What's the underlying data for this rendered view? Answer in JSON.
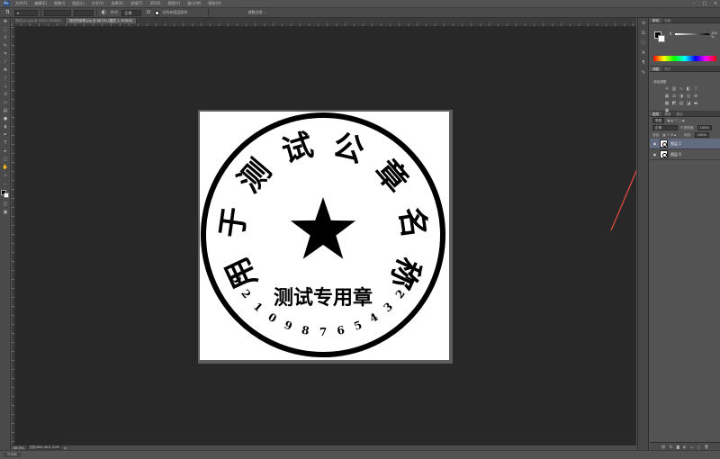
{
  "menu": {
    "app_logo": "Ps",
    "items": [
      "文件(F)",
      "编辑(E)",
      "图像(I)",
      "图层(L)",
      "文字(Y)",
      "选择(S)",
      "滤镜(T)",
      "3D(D)",
      "视图(V)",
      "窗口(W)",
      "帮助(H)"
    ]
  },
  "options": {
    "tool_icon": "quick-select-icon",
    "style_value": "正常",
    "sample_label": "样式:",
    "checkbox_label": "对所有图层取样",
    "edge_button": "调整边缘..."
  },
  "doc": {
    "tabs": [
      "测试-p1.jpg @ 100% (RGB/8)",
      "测试专用章.jpg @ 68.5% (图层 1, RGB/8)"
    ],
    "zoom": "68.5%",
    "doc_info": "文档:800.0K/1.02M"
  },
  "stamp": {
    "arc_text": [
      "用",
      "于",
      "测",
      "试",
      "公",
      "章",
      "名",
      "称"
    ],
    "center_text": "测试专用章",
    "number_text": [
      "1",
      "2",
      "3",
      "4",
      "5",
      "6",
      "7",
      "8",
      "9",
      "0",
      "1",
      "2",
      "3"
    ]
  },
  "color_panel": {
    "tabs": [
      "颜色",
      "色板"
    ],
    "channel_label": "K",
    "value": "100",
    "unit": "%"
  },
  "adjust_panel": {
    "tabs": [
      "调整",
      "样式"
    ],
    "title": "添加调整"
  },
  "layers_panel": {
    "tabs": [
      "图层",
      "通道",
      "路径"
    ],
    "kind_label": "类型",
    "blend_mode": "正常",
    "opacity_label": "不透明度:",
    "opacity_value": "100%",
    "lock_label": "锁定:",
    "fill_label": "填充:",
    "fill_value": "100%",
    "layers": [
      {
        "name": "图层 1",
        "selected": true
      },
      {
        "name": "图层 0",
        "selected": false
      }
    ]
  },
  "bottom_tab": "时间轴",
  "colors": {
    "annotation_arrow": "#e84b3c",
    "selected_layer": "#626b80"
  }
}
